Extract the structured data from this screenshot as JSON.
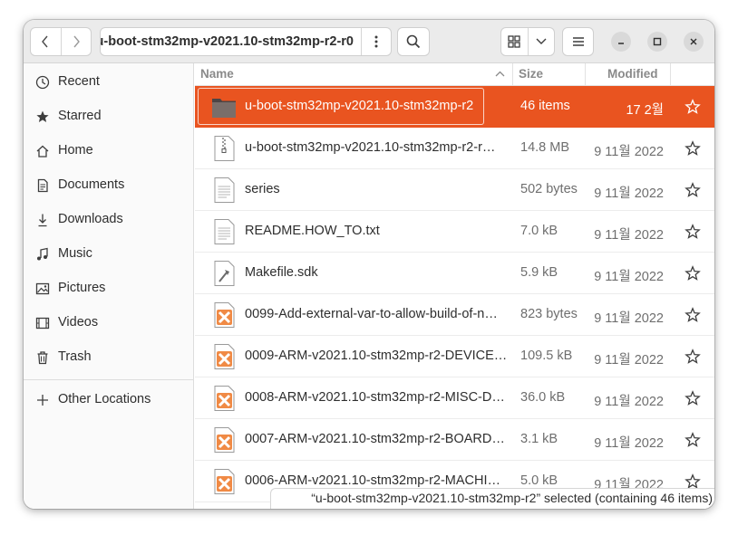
{
  "header": {
    "path": "u-boot-stm32mp-v2021.10-stm32mp-r2-r0",
    "back_icon": "chevron-left",
    "forward_icon": "chevron-right",
    "path_menu_icon": "vertical-dots",
    "search_icon": "magnifier",
    "view_icon": "grid",
    "view_dropdown_icon": "chevron-down",
    "menu_icon": "hamburger",
    "minimize_icon": "minus",
    "maximize_icon": "square",
    "close_icon": "x"
  },
  "sidebar": {
    "items": [
      {
        "label": "Recent",
        "icon": "clock"
      },
      {
        "label": "Starred",
        "icon": "star"
      },
      {
        "label": "Home",
        "icon": "home"
      },
      {
        "label": "Documents",
        "icon": "document"
      },
      {
        "label": "Downloads",
        "icon": "download"
      },
      {
        "label": "Music",
        "icon": "music"
      },
      {
        "label": "Pictures",
        "icon": "picture"
      },
      {
        "label": "Videos",
        "icon": "video"
      },
      {
        "label": "Trash",
        "icon": "trash"
      }
    ],
    "other": {
      "label": "Other Locations",
      "icon": "plus"
    }
  },
  "columns": {
    "name": "Name",
    "size": "Size",
    "modified": "Modified"
  },
  "files": [
    {
      "name": "u-boot-stm32mp-v2021.10-stm32mp-r2",
      "size": "46 items",
      "modified": "17  2월",
      "type": "folder",
      "selected": true
    },
    {
      "name": "u-boot-stm32mp-v2021.10-stm32mp-r2-r…",
      "size": "14.8 MB",
      "modified": "9 11월 2022",
      "type": "archive"
    },
    {
      "name": "series",
      "size": "502 bytes",
      "modified": "9 11월 2022",
      "type": "text"
    },
    {
      "name": "README.HOW_TO.txt",
      "size": "7.0 kB",
      "modified": "9 11월 2022",
      "type": "text"
    },
    {
      "name": "Makefile.sdk",
      "size": "5.9 kB",
      "modified": "9 11월 2022",
      "type": "makefile"
    },
    {
      "name": "0099-Add-external-var-to-allow-build-of-n…",
      "size": "823 bytes",
      "modified": "9 11월 2022",
      "type": "patch"
    },
    {
      "name": "0009-ARM-v2021.10-stm32mp-r2-DEVICE…",
      "size": "109.5 kB",
      "modified": "9 11월 2022",
      "type": "patch"
    },
    {
      "name": "0008-ARM-v2021.10-stm32mp-r2-MISC-D…",
      "size": "36.0 kB",
      "modified": "9 11월 2022",
      "type": "patch"
    },
    {
      "name": "0007-ARM-v2021.10-stm32mp-r2-BOARD.…",
      "size": "3.1 kB",
      "modified": "9 11월 2022",
      "type": "patch"
    },
    {
      "name": "0006-ARM-v2021.10-stm32mp-r2-MACHI…",
      "size": "5.0 kB",
      "modified": "9 11월 2022",
      "type": "patch"
    }
  ],
  "status": {
    "text": "“u-boot-stm32mp-v2021.10-stm32mp-r2” selected  (containing 46 items)"
  },
  "colors": {
    "accent": "#e95420",
    "folder": "#7a6e6a",
    "patch": "#f08a45"
  }
}
